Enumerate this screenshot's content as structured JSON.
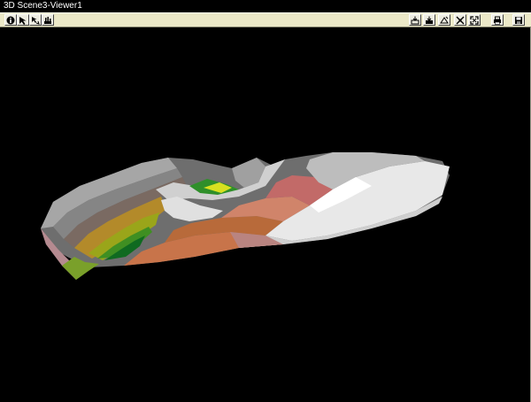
{
  "window": {
    "title": "3D Scene3-Viewer1"
  },
  "toolbar": {
    "left_tools": [
      {
        "icon": "info-icon"
      },
      {
        "icon": "select-arrow-icon"
      },
      {
        "icon": "rotate-tool-icon"
      },
      {
        "icon": "scene-tool-icon"
      }
    ],
    "right_tools": [
      {
        "icon": "view-front-icon"
      },
      {
        "icon": "view-side-icon"
      },
      {
        "icon": "view-top-icon"
      },
      {
        "icon": "zoom-fit-icon"
      },
      {
        "icon": "fullscreen-icon"
      },
      {
        "icon": "print-icon"
      },
      {
        "icon": "save-icon"
      }
    ]
  },
  "colors": {
    "title_bg": "#000000",
    "title_text": "#ffffff",
    "toolbar_bg": "#ece9c8",
    "viewport_bg": "#000000"
  },
  "scene": {
    "description_icon": "terrain-surface-model"
  }
}
